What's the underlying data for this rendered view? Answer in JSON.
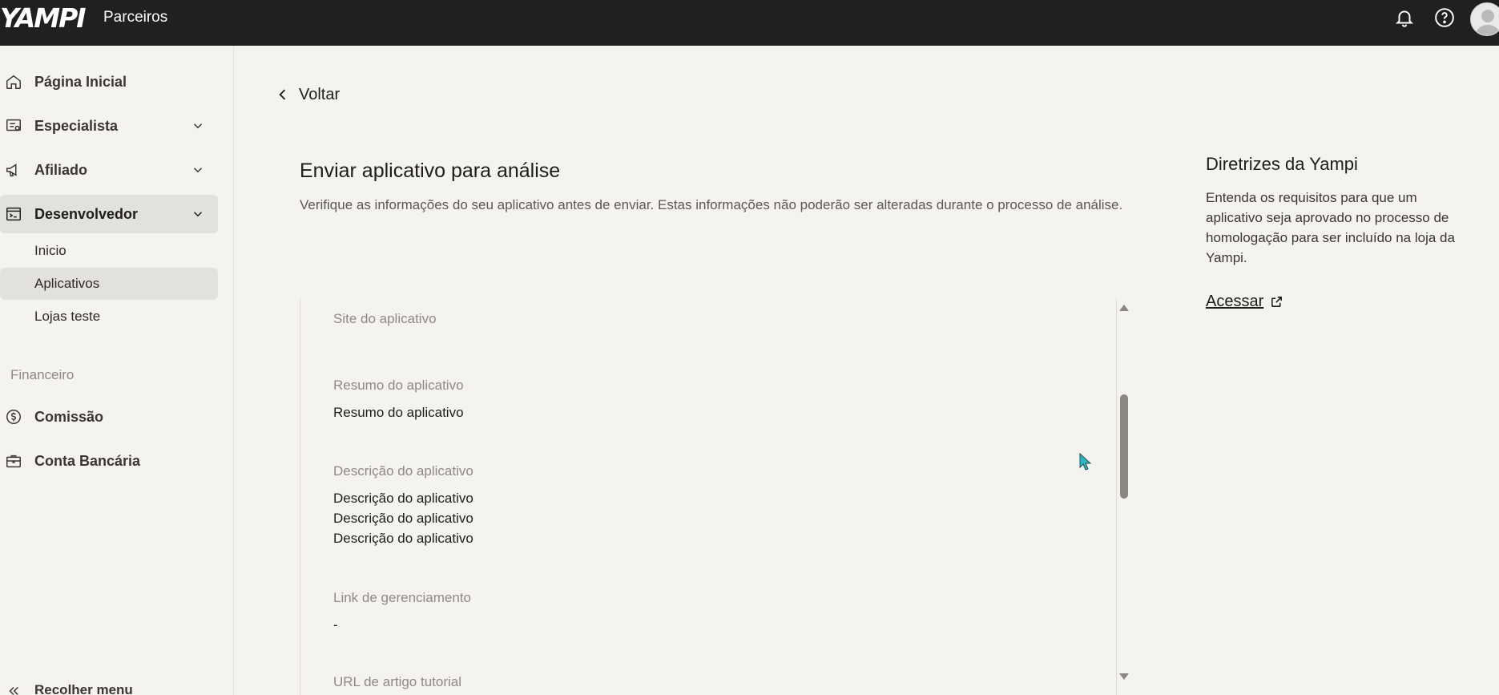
{
  "topbar": {
    "logo_text": "YAMPI",
    "product_label": "Parceiros",
    "icons": [
      "bell-icon",
      "help-icon",
      "avatar"
    ]
  },
  "sidebar": {
    "items": [
      {
        "label": "Página Inicial",
        "icon": "home-icon"
      },
      {
        "label": "Especialista",
        "icon": "badge-icon"
      },
      {
        "label": "Afiliado",
        "icon": "megaphone-icon"
      },
      {
        "label": "Desenvolvedor",
        "icon": "terminal-icon"
      }
    ],
    "developer_subitems": [
      {
        "label": "Inicio"
      },
      {
        "label": "Aplicativos"
      },
      {
        "label": "Lojas teste"
      }
    ],
    "financeiro_title": "Financeiro",
    "finance_items": [
      {
        "label": "Comissão",
        "icon": "dollar-icon"
      },
      {
        "label": "Conta Bancária",
        "icon": "briefcase-icon"
      }
    ],
    "collapse_label": "Recolher menu"
  },
  "main": {
    "back_label": "Voltar",
    "title": "Enviar aplicativo para análise",
    "description": "Verifique as informações do seu aplicativo antes de enviar. Estas informações não poderão ser alteradas durante o processo de análise.",
    "fields": [
      {
        "label": "Site do aplicativo",
        "value": ""
      },
      {
        "label": "Resumo do aplicativo",
        "value": "Resumo do aplicativo"
      },
      {
        "label": "Descrição do aplicativo",
        "value_lines": [
          "Descrição do aplicativo",
          "Descrição do aplicativo",
          "Descrição do aplicativo"
        ]
      },
      {
        "label": "Link de gerenciamento",
        "value": "-"
      },
      {
        "label": "URL de artigo tutorial",
        "value": ""
      }
    ]
  },
  "guide": {
    "title": "Diretrizes da Yampi",
    "text": "Entenda os requisitos para que um aplicativo seja aprovado no processo de homologação para ser incluído na loja da Yampi.",
    "link_label": "Acessar"
  },
  "colors": {
    "topbar_bg": "#221f1f",
    "page_bg": "#f4f3ef",
    "active_bg": "#e3e1dc",
    "muted_text": "#8e8a85"
  }
}
